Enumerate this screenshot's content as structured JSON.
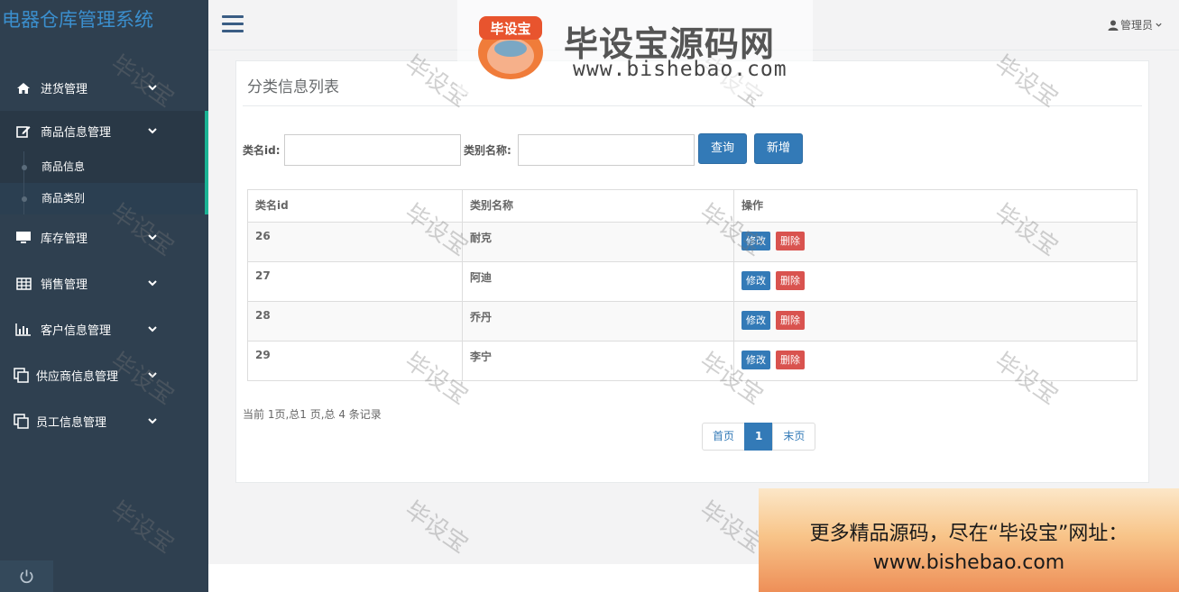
{
  "app": {
    "title": "电器仓库管理系统"
  },
  "sidebar": {
    "items": [
      {
        "label": "进货管理",
        "icon": "home-icon"
      },
      {
        "label": "商品信息管理",
        "icon": "edit-icon",
        "open": true,
        "children": [
          {
            "label": "商品信息"
          },
          {
            "label": "商品类别",
            "active": true
          }
        ]
      },
      {
        "label": "库存管理",
        "icon": "desktop-icon"
      },
      {
        "label": "销售管理",
        "icon": "table-icon"
      },
      {
        "label": "客户信息管理",
        "icon": "bar-chart-icon"
      },
      {
        "label": "供应商信息管理",
        "icon": "copy-icon"
      },
      {
        "label": "员工信息管理",
        "icon": "copy-icon"
      }
    ]
  },
  "header": {
    "user_label": "管理员"
  },
  "main": {
    "panel_title": "分类信息列表",
    "search": {
      "id_label": "类名id:",
      "id_value": "",
      "name_label": "类别名称:",
      "name_value": "",
      "query_button": "查询",
      "add_button": "新增"
    },
    "table": {
      "columns": [
        "类名id",
        "类别名称",
        "操作"
      ],
      "rows": [
        {
          "id": "26",
          "name": "耐克"
        },
        {
          "id": "27",
          "name": "阿迪"
        },
        {
          "id": "28",
          "name": "乔丹"
        },
        {
          "id": "29",
          "name": "李宁"
        }
      ],
      "edit_label": "修改",
      "delete_label": "删除"
    },
    "records_text": "当前 1页,总1 页,总 4 条记录",
    "pagination": {
      "first": "首页",
      "current": "1",
      "last": "末页"
    }
  },
  "watermark": {
    "text": "毕设宝"
  },
  "logo": {
    "badge": "毕设宝",
    "name": "毕设宝源码网",
    "url": "www.bishebao.com"
  },
  "ad": {
    "line1": "更多精品源码，尽在“毕设宝”网址：",
    "line2": "www.bishebao.com"
  },
  "colors": {
    "sidebar": "#2f4050",
    "accent": "#1ab394",
    "primary": "#337ab7",
    "danger": "#d9534f"
  }
}
